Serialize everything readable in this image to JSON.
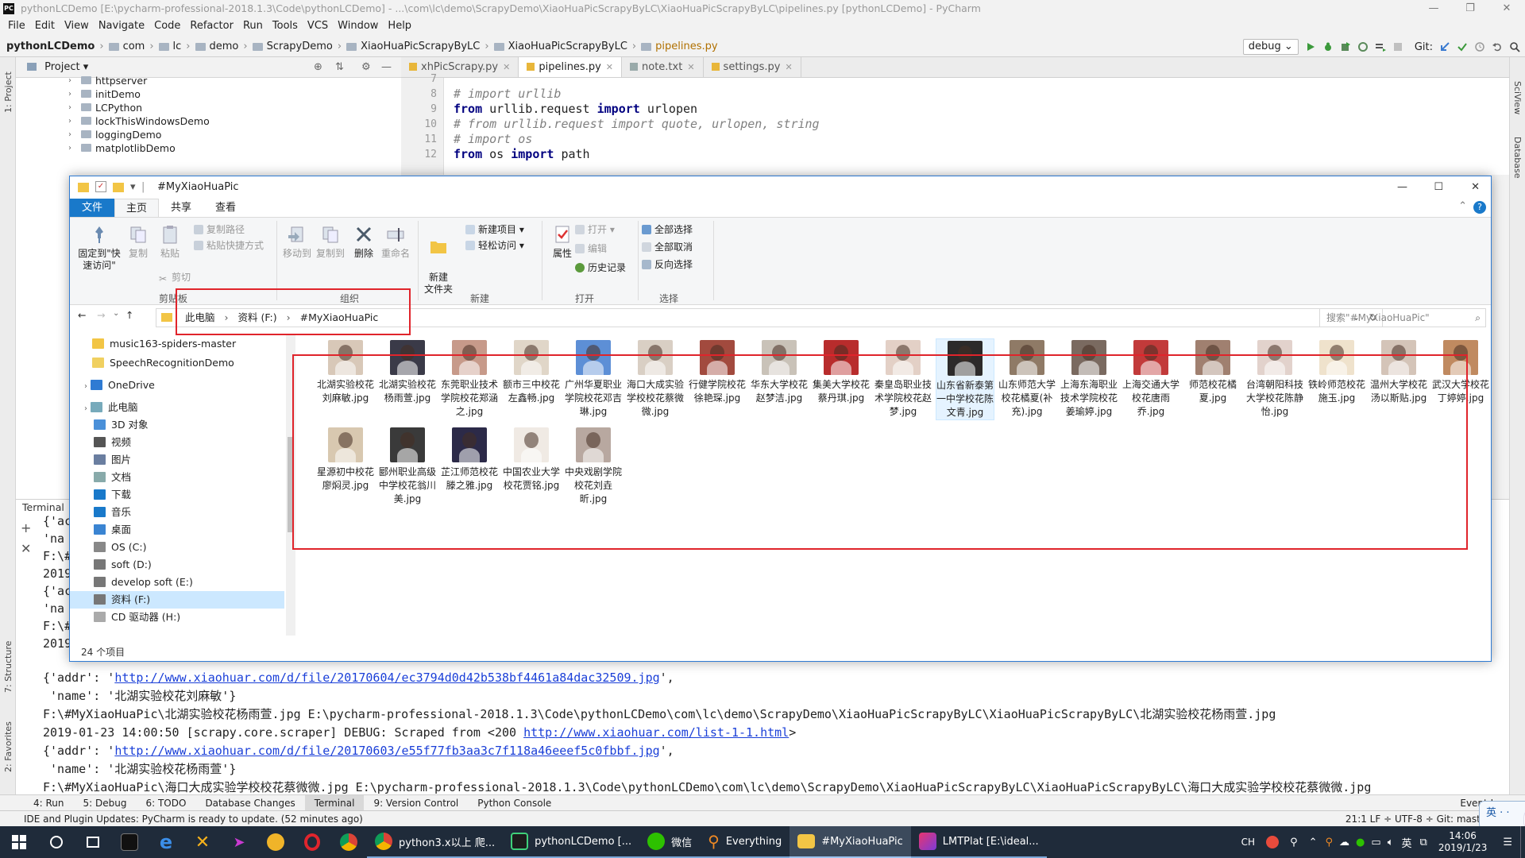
{
  "pycharm": {
    "title": "pythonLCDemo [E:\\pycharm-professional-2018.1.3\\Code\\pythonLCDemo] - ...\\com\\lc\\demo\\ScrapyDemo\\XiaoHuaPicScrapyByLC\\XiaoHuaPicScrapyByLC\\pipelines.py [pythonLCDemo] - PyCharm",
    "app_icon": "PC",
    "menu": [
      "File",
      "Edit",
      "View",
      "Navigate",
      "Code",
      "Refactor",
      "Run",
      "Tools",
      "VCS",
      "Window",
      "Help"
    ],
    "breadcrumbs": [
      "pythonLCDemo",
      "com",
      "lc",
      "demo",
      "ScrapyDemo",
      "XiaoHuaPicScrapyByLC",
      "XiaoHuaPicScrapyByLC",
      "pipelines.py"
    ],
    "run_config": "debug",
    "git_label": "Git:",
    "project_label": "Project",
    "left_strip": [
      "1: Project",
      "2: Favorites",
      "7: Structure"
    ],
    "right_strip": [
      "SciView",
      "Database"
    ],
    "tree": [
      "httpserver",
      "initDemo",
      "LCPython",
      "lockThisWindowsDemo",
      "loggingDemo",
      "matplotlibDemo"
    ],
    "tabs": [
      "xhPicScrapy.py",
      "pipelines.py",
      "note.txt",
      "settings.py"
    ],
    "code": [
      {
        "n": "7",
        "t": ""
      },
      {
        "n": "8",
        "t": "# import urllib"
      },
      {
        "n": "9",
        "t": "from urllib.request import urlopen"
      },
      {
        "n": "10",
        "t": "# from urllib.request import quote, urlopen, string"
      },
      {
        "n": "11",
        "t": "# import os"
      },
      {
        "n": "12",
        "t": "from os import path"
      }
    ],
    "terminal_label": "Terminal",
    "term_left": [
      "{'ac",
      "'na",
      "F:\\#",
      "2019",
      "{'ac",
      "'na",
      "F:\\#",
      "2019"
    ],
    "term_lines": [
      {
        "a": "{'addr': '",
        "u": "http://www.xiaohuar.com/d/file/20170604/ec3794d0d42b538bf4461a84dac32509.jpg",
        "b": "',"
      },
      {
        "a": " 'name': '北湖实验校花刘麻敏'}",
        "u": "",
        "b": ""
      },
      {
        "a": "F:\\#MyXiaoHuaPic\\北湖实验校花杨雨萱.jpg E:\\pycharm-professional-2018.1.3\\Code\\pythonLCDemo\\com\\lc\\demo\\ScrapyDemo\\XiaoHuaPicScrapyByLC\\XiaoHuaPicScrapyByLC\\北湖实验校花杨雨萱.jpg",
        "u": "",
        "b": ""
      },
      {
        "a": "2019-01-23 14:00:50 [scrapy.core.scraper] DEBUG: Scraped from <200 ",
        "u": "http://www.xiaohuar.com/list-1-1.html",
        "b": ">"
      },
      {
        "a": "{'addr': '",
        "u": "http://www.xiaohuar.com/d/file/20170603/e55f77fb3aa3c7f118a46eeef5c0fbbf.jpg",
        "b": "',"
      },
      {
        "a": " 'name': '北湖实验校花杨雨萱'}",
        "u": "",
        "b": ""
      },
      {
        "a": "F:\\#MyXiaoHuaPic\\海口大成实验学校校花蔡微微.jpg E:\\pycharm-professional-2018.1.3\\Code\\pythonLCDemo\\com\\lc\\demo\\ScrapyDemo\\XiaoHuaPicScrapyByLC\\XiaoHuaPicScrapyByLC\\海口大成实验学校校花蔡微微.jpg",
        "u": "",
        "b": ""
      }
    ],
    "bottom_tabs": [
      "4: Run",
      "5: Debug",
      "6: TODO",
      "Database Changes",
      "Terminal",
      "9: Version Control",
      "Python Console",
      "Event Log"
    ],
    "status_msg": "IDE and Plugin Updates: PyCharm is ready to update. (52 minutes ago)",
    "status_right": "21:1   LF ÷   UTF-8 ÷   Git: master ÷"
  },
  "explorer": {
    "title": "#MyXiaoHuaPic",
    "ribbon_tabs": [
      "文件",
      "主页",
      "共享",
      "查看"
    ],
    "btn": {
      "pin": "固定到\"快速访问\"",
      "copy": "复制",
      "paste": "粘贴",
      "copypath": "复制路径",
      "pasteshortcut": "粘贴快捷方式",
      "cut": "剪切",
      "moveto": "移动到",
      "copyto": "复制到",
      "delete": "删除",
      "rename": "重命名",
      "newfolder": "新建\n文件夹",
      "newitem": "新建项目 ▾",
      "easyaccess": "轻松访问 ▾",
      "props": "属性",
      "open": "打开 ▾",
      "edit": "编辑",
      "history": "历史记录",
      "selall": "全部选择",
      "selnone": "全部取消",
      "invert": "反向选择"
    },
    "groups": [
      "剪贴板",
      "组织",
      "新建",
      "打开",
      "选择"
    ],
    "addr": [
      "此电脑",
      "资料 (F:)",
      "#MyXiaoHuaPic"
    ],
    "search_placeholder": "搜索\"#MyXiaoHuaPic\"",
    "nav": [
      "music163-spiders-master",
      "SpeechRecognitionDemo",
      "OneDrive",
      "此电脑",
      "3D 对象",
      "视频",
      "图片",
      "文档",
      "下载",
      "音乐",
      "桌面",
      "OS (C:)",
      "soft (D:)",
      "develop soft (E:)",
      "资料 (F:)",
      "CD 驱动器 (H:)"
    ],
    "files": [
      "北湖实验校花刘麻敏.jpg",
      "北湖实验校花杨雨萱.jpg",
      "东莞职业技术学院校花郑涵之.jpg",
      "额市三中校花左鑫畅.jpg",
      "广州华夏职业学院校花邓吉琳.jpg",
      "海口大成实验学校校花蔡微微.jpg",
      "行健学院校花徐艳琛.jpg",
      "华东大学校花赵梦洁.jpg",
      "集美大学校花蔡丹琪.jpg",
      "秦皇岛职业技术学院校花赵梦.jpg",
      "山东省新泰第一中学校花陈文青.jpg",
      "山东师范大学校花橘夏(补充).jpg",
      "上海东海职业技术学院校花姜瑜婷.jpg",
      "上海交通大学校花唐雨乔.jpg",
      "师范校花橘夏.jpg",
      "台湾朝阳科技大学校花陈静怡.jpg",
      "铁岭师范校花施玉.jpg",
      "温州大学校花汤以斯贴.jpg",
      "武汉大学校花丁婷婷.jpg",
      "星源初中校花廖焖灵.jpg",
      "郾州职业高级中学校花翁川美.jpg",
      "芷江师范校花滕之雅.jpg",
      "中国农业大学校花贾铭.jpg",
      "中央戏剧学院校花刘垚昕.jpg"
    ],
    "item_count": "24 个项目",
    "thumb_colors": [
      "#d8c8b8",
      "#3a3a48",
      "#c79a8a",
      "#e0d6c8",
      "#5d8fd6",
      "#d9cfc4",
      "#a24a3e",
      "#c9c2b8",
      "#b82c2c",
      "#e3d0c6",
      "#2c2a2a",
      "#8f7a66",
      "#7a6a60",
      "#c23a3a",
      "#a08070",
      "#e2d2cc",
      "#efe2cc",
      "#d4c4b8",
      "#c08a60",
      "#d8c8b0",
      "#3a3a3a",
      "#2c2a48",
      "#f0eae4",
      "#b8a8a0"
    ]
  },
  "taskbar": {
    "apps": [
      "python3.x以上 爬...",
      "pythonLCDemo [...",
      "微信",
      "Everything",
      "#MyXiaoHuaPic",
      "LMTPlat [E:\\ideal..."
    ],
    "tray_lang": "CH",
    "ime": "英",
    "time": "14:06",
    "date": "2019/1/23"
  },
  "colors": {
    "accent": "#1979ca",
    "red_annotation": "#e0242b",
    "taskbar": "#1f2b3a"
  }
}
